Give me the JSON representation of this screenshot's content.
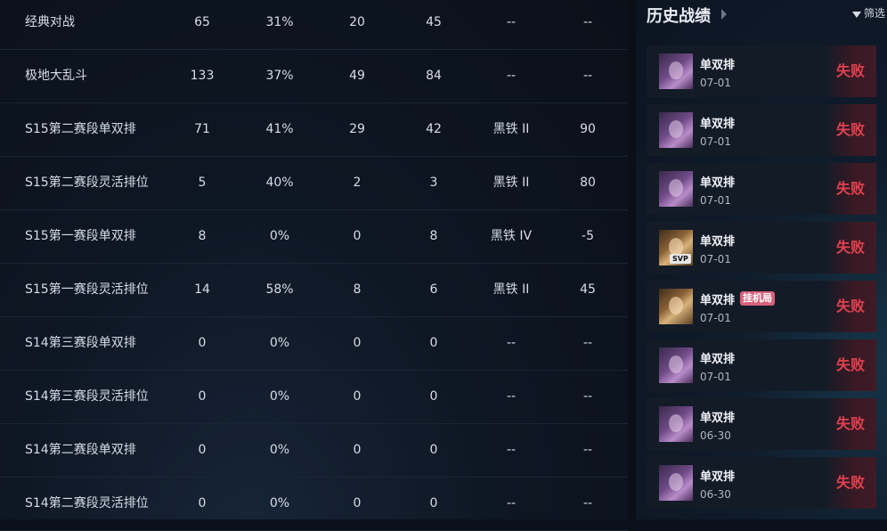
{
  "stats_table": {
    "rows": [
      {
        "name": "经典对战",
        "games": "65",
        "winrate": "31%",
        "wins": "20",
        "losses": "45",
        "tier": "--",
        "lp": "--"
      },
      {
        "name": "极地大乱斗",
        "games": "133",
        "winrate": "37%",
        "wins": "49",
        "losses": "84",
        "tier": "--",
        "lp": "--"
      },
      {
        "name": "S15第二赛段单双排",
        "games": "71",
        "winrate": "41%",
        "wins": "29",
        "losses": "42",
        "tier": "黑铁 II",
        "lp": "90"
      },
      {
        "name": "S15第二赛段灵活排位",
        "games": "5",
        "winrate": "40%",
        "wins": "2",
        "losses": "3",
        "tier": "黑铁 II",
        "lp": "80"
      },
      {
        "name": "S15第一赛段单双排",
        "games": "8",
        "winrate": "0%",
        "wins": "0",
        "losses": "8",
        "tier": "黑铁 IV",
        "lp": "-5"
      },
      {
        "name": "S15第一赛段灵活排位",
        "games": "14",
        "winrate": "58%",
        "wins": "8",
        "losses": "6",
        "tier": "黑铁 II",
        "lp": "45"
      },
      {
        "name": "S14第三赛段单双排",
        "games": "0",
        "winrate": "0%",
        "wins": "0",
        "losses": "0",
        "tier": "--",
        "lp": "--"
      },
      {
        "name": "S14第三赛段灵活排位",
        "games": "0",
        "winrate": "0%",
        "wins": "0",
        "losses": "0",
        "tier": "--",
        "lp": "--"
      },
      {
        "name": "S14第二赛段单双排",
        "games": "0",
        "winrate": "0%",
        "wins": "0",
        "losses": "0",
        "tier": "--",
        "lp": "--"
      },
      {
        "name": "S14第二赛段灵活排位",
        "games": "0",
        "winrate": "0%",
        "wins": "0",
        "losses": "0",
        "tier": "--",
        "lp": "--"
      }
    ]
  },
  "history": {
    "title": "历史战绩",
    "filter_label": "筛选",
    "matches": [
      {
        "queue": "单双排",
        "date": "07-01",
        "result": "失败",
        "avatar": "purple",
        "badge": "",
        "tag": ""
      },
      {
        "queue": "单双排",
        "date": "07-01",
        "result": "失败",
        "avatar": "purple",
        "badge": "",
        "tag": ""
      },
      {
        "queue": "单双排",
        "date": "07-01",
        "result": "失败",
        "avatar": "purple",
        "badge": "",
        "tag": ""
      },
      {
        "queue": "单双排",
        "date": "07-01",
        "result": "失败",
        "avatar": "gold",
        "badge": "SVP",
        "tag": ""
      },
      {
        "queue": "单双排",
        "date": "07-01",
        "result": "失败",
        "avatar": "gold",
        "badge": "",
        "tag": "挂机局"
      },
      {
        "queue": "单双排",
        "date": "07-01",
        "result": "失败",
        "avatar": "purple",
        "badge": "",
        "tag": ""
      },
      {
        "queue": "单双排",
        "date": "06-30",
        "result": "失败",
        "avatar": "purple",
        "badge": "",
        "tag": ""
      },
      {
        "queue": "单双排",
        "date": "06-30",
        "result": "失败",
        "avatar": "purple",
        "badge": "",
        "tag": ""
      }
    ]
  },
  "colors": {
    "loss": "#e2404f",
    "afk_tag": "#d9607a"
  }
}
